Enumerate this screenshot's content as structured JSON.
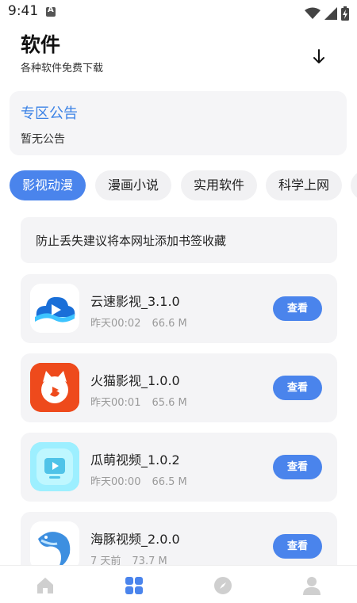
{
  "status_bar": {
    "time": "9:41",
    "notification_icon": "a-icon",
    "icons": [
      "wifi-icon",
      "signal-icon",
      "battery-charging-icon"
    ]
  },
  "header": {
    "title": "软件",
    "subtitle": "各种软件免费下载",
    "download_icon": "download-arrow-icon"
  },
  "notice": {
    "title": "专区公告",
    "text": "暂无公告"
  },
  "tabs": [
    {
      "label": "影视动漫",
      "active": true
    },
    {
      "label": "漫画小说",
      "active": false
    },
    {
      "label": "实用软件",
      "active": false
    },
    {
      "label": "科学上网",
      "active": false
    }
  ],
  "tip": {
    "text": "防止丢失建议将本网址添加书签收藏"
  },
  "apps": [
    {
      "name": "云速影视_3.1.0",
      "time": "昨天00:02",
      "size": "66.6 M",
      "button": "查看",
      "icon": "cloud-play-icon"
    },
    {
      "name": "火猫影视_1.0.0",
      "time": "昨天00:01",
      "size": "65.6 M",
      "button": "查看",
      "icon": "fire-cat-icon"
    },
    {
      "name": "瓜萌视频_1.0.2",
      "time": "昨天00:00",
      "size": "66.5 M",
      "button": "查看",
      "icon": "video-play-icon"
    },
    {
      "name": "海豚视频_2.0.0",
      "time": "7 天前",
      "size": "73.7 M",
      "button": "查看",
      "icon": "dolphin-icon"
    }
  ],
  "bottom_nav": [
    {
      "name": "home-icon",
      "active": false
    },
    {
      "name": "grid-icon",
      "active": true
    },
    {
      "name": "compass-icon",
      "active": false
    },
    {
      "name": "profile-icon",
      "active": false
    }
  ],
  "colors": {
    "accent": "#4a84ec",
    "notice_title": "#3b82e6",
    "card_bg": "#f4f4f6",
    "inactive_icon": "#cfcfcf"
  }
}
